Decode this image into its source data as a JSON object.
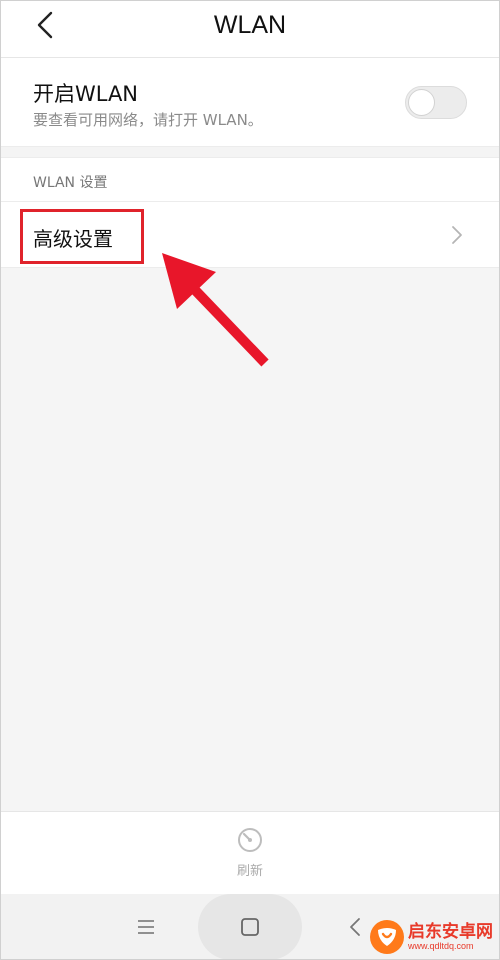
{
  "header": {
    "title": "WLAN"
  },
  "wlan_toggle": {
    "title": "开启WLAN",
    "subtitle": "要查看可用网络，请打开 WLAN。",
    "enabled": false
  },
  "section": {
    "label": "WLAN 设置"
  },
  "advanced": {
    "label": "高级设置"
  },
  "bottom_bar": {
    "refresh_label": "刷新"
  },
  "watermark": {
    "name": "启东安卓网",
    "url": "www.qdltdq.com"
  },
  "colors": {
    "highlight": "#e0232b",
    "arrow": "#e8162a",
    "watermark": "#e83a2a"
  },
  "icons": {
    "back": "chevron-left-icon",
    "chevron": "chevron-right-icon",
    "refresh": "refresh-icon",
    "menu": "menu-icon",
    "home": "square-home-icon",
    "nav_back": "nav-back-icon"
  }
}
